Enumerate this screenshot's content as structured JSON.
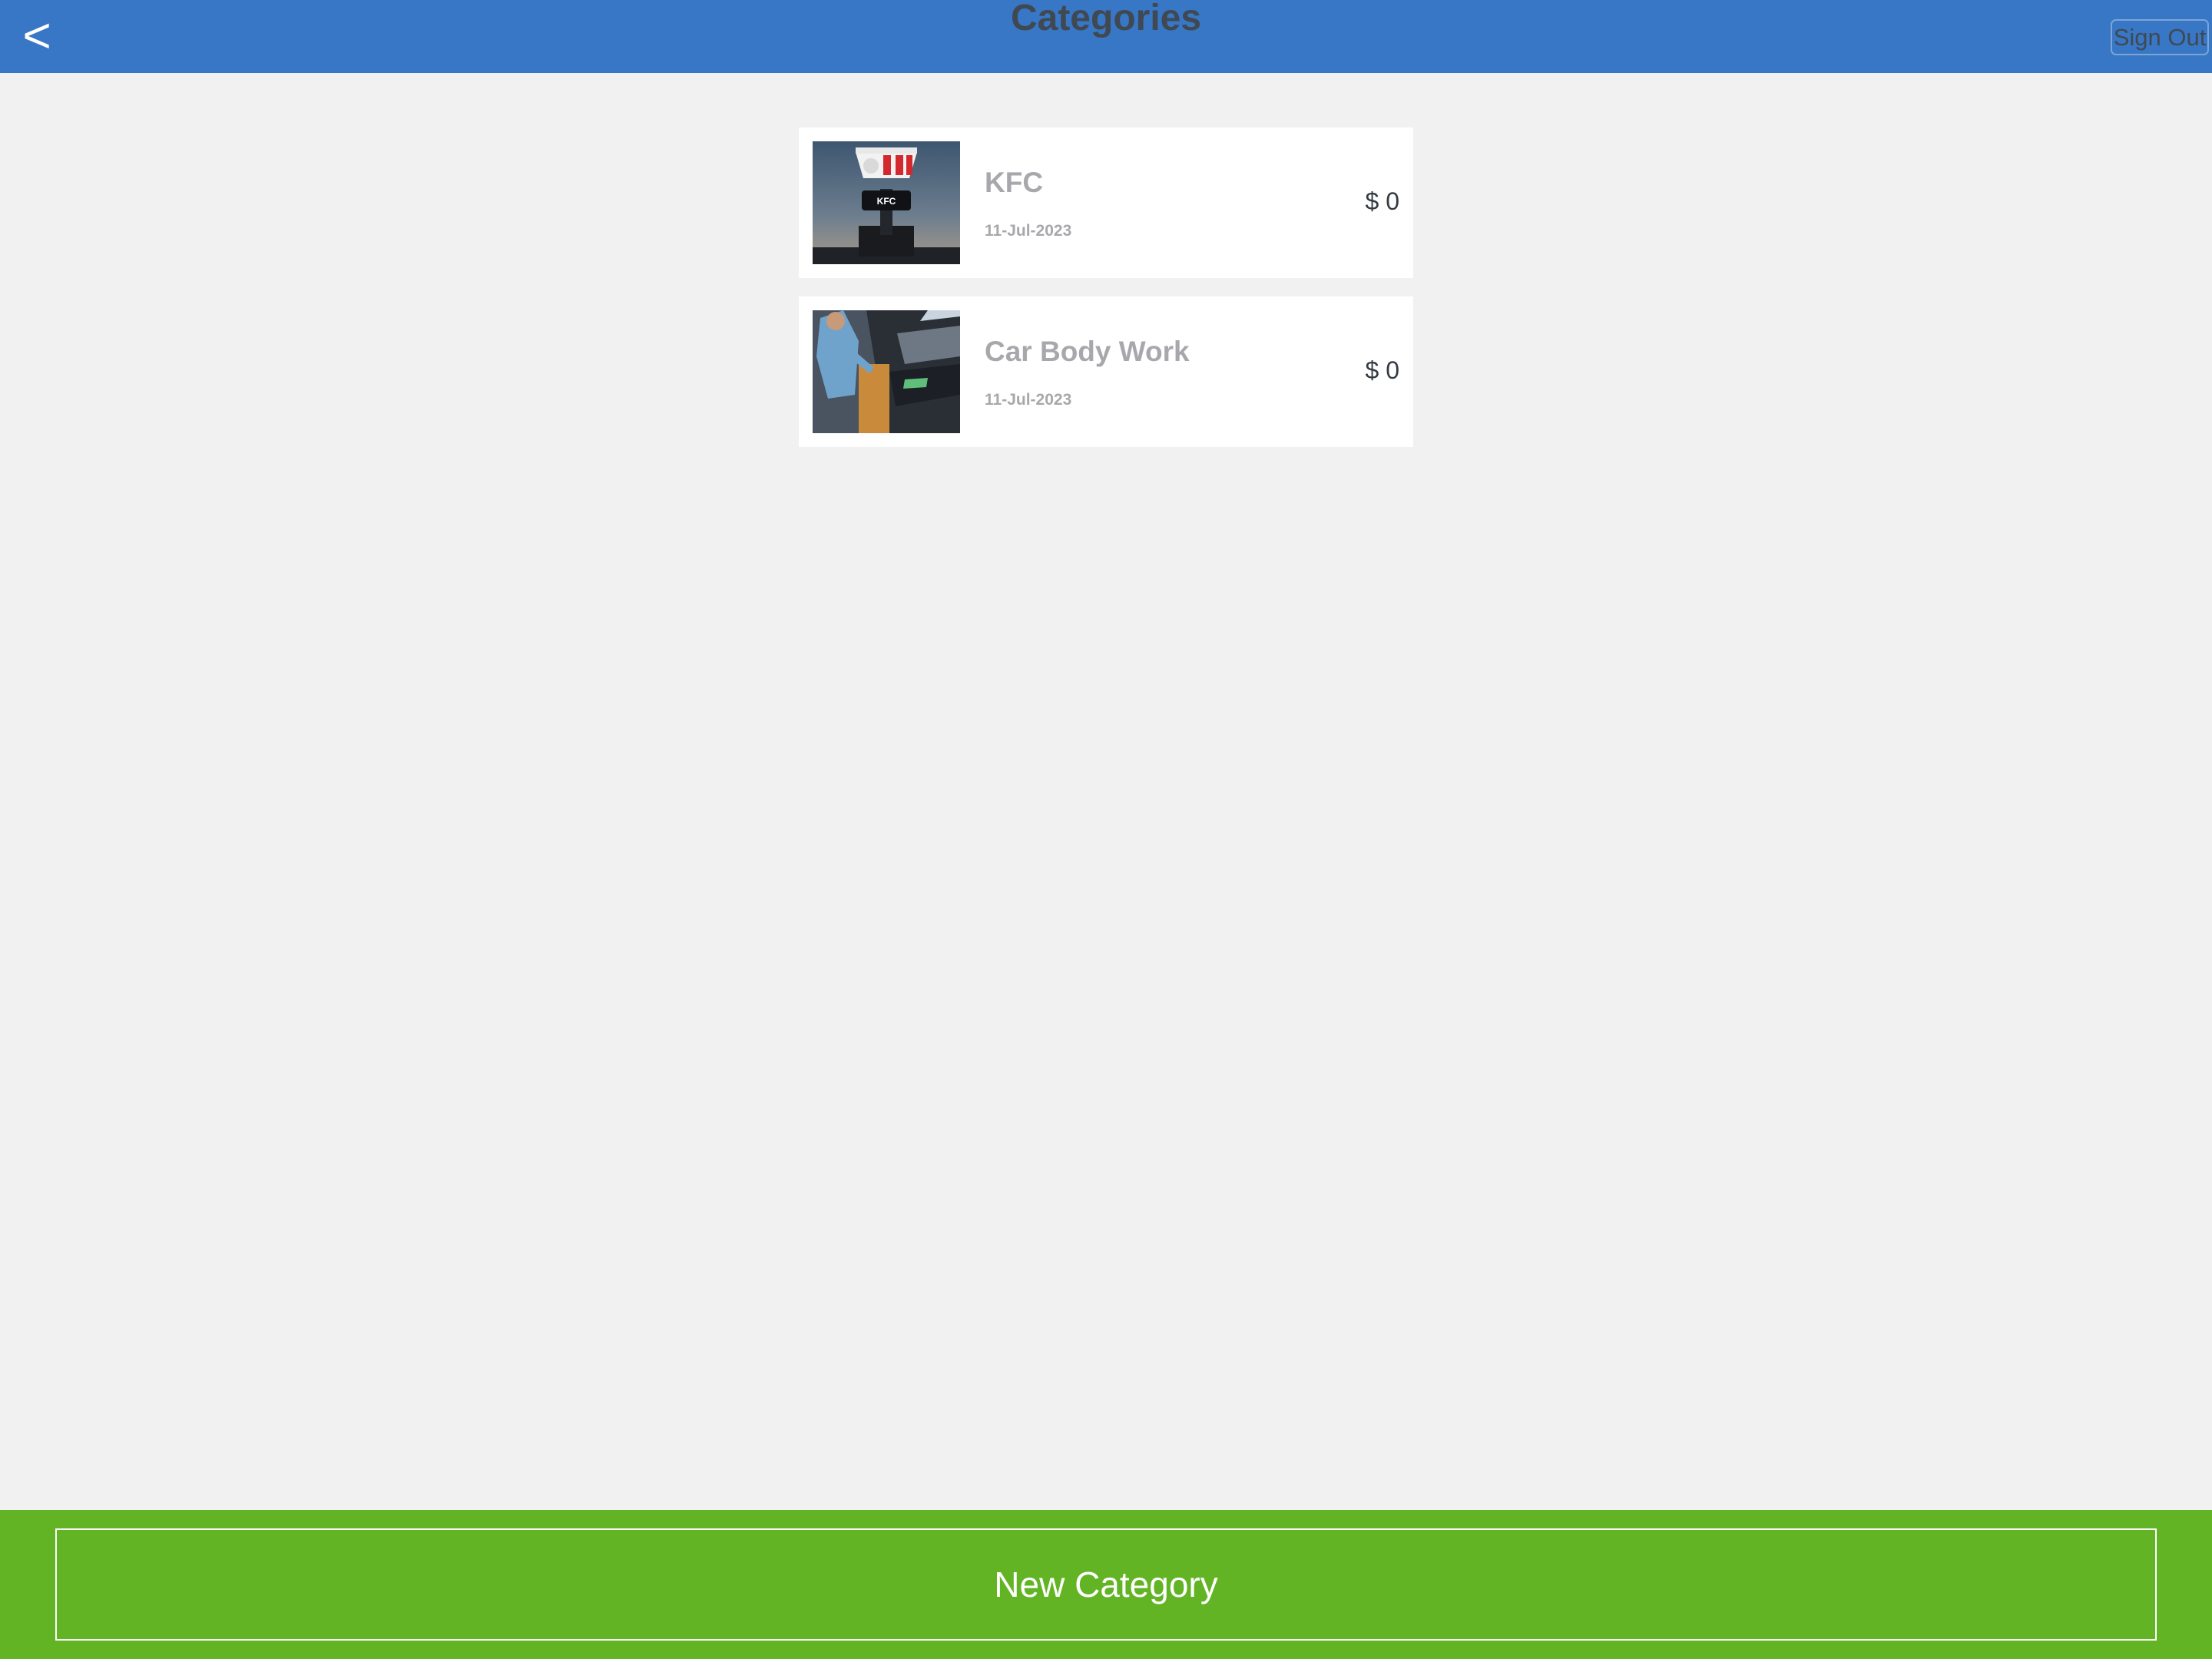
{
  "header": {
    "back_label": "<",
    "title": "Categories",
    "signout_label": "Sign Out",
    "background_color": "#3777c5"
  },
  "categories": [
    {
      "name": "KFC",
      "date": "11-Jul-2023",
      "amount": "$ 0",
      "image": "kfc-sign-photo"
    },
    {
      "name": "Car Body Work",
      "date": "11-Jul-2023",
      "amount": "$ 0",
      "image": "car-body-work-photo"
    }
  ],
  "footer": {
    "new_button_label": "New Category",
    "background_color": "#62b425"
  }
}
